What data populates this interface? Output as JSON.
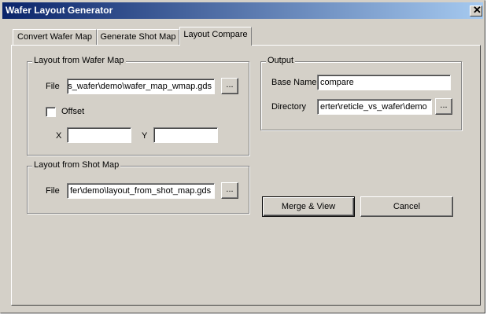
{
  "window": {
    "title": "Wafer Layout Generator",
    "close_glyph": "✕"
  },
  "tabs": [
    {
      "label": "Convert Wafer Map"
    },
    {
      "label": "Generate Shot Map"
    },
    {
      "label": "Layout Compare"
    }
  ],
  "layout_from_wafer_map": {
    "group_label": "Layout from Wafer Map",
    "file_label": "File",
    "file_value": "s_wafer\\demo\\wafer_map_wmap.gds",
    "browse_label": "...",
    "offset_label": "Offset",
    "offset_checked": false,
    "x_label": "X",
    "x_value": "",
    "y_label": "Y",
    "y_value": ""
  },
  "layout_from_shot_map": {
    "group_label": "Layout from Shot Map",
    "file_label": "File",
    "file_value": "fer\\demo\\layout_from_shot_map.gds",
    "browse_label": "..."
  },
  "output": {
    "group_label": "Output",
    "base_name_label": "Base Name",
    "base_name_value": "compare",
    "directory_label": "Directory",
    "directory_value": "erter\\reticle_vs_wafer\\demo",
    "browse_label": "..."
  },
  "actions": {
    "merge_view_label": "Merge & View",
    "cancel_label": "Cancel"
  }
}
